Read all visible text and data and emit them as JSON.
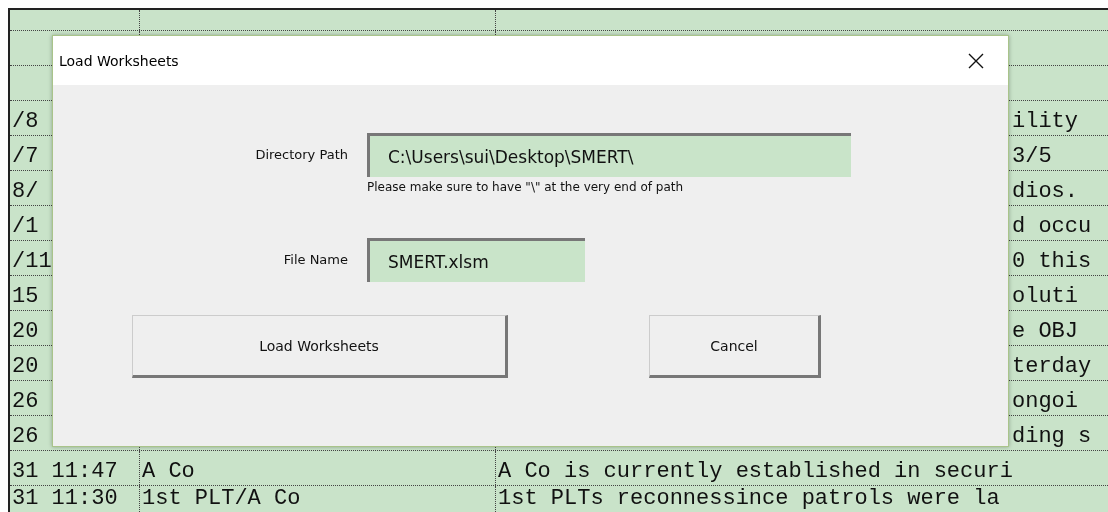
{
  "sheet": {
    "rows": [
      {
        "cells": [
          "",
          "",
          ""
        ]
      },
      {
        "cells": [
          "",
          "",
          ""
        ]
      },
      {
        "cells": [
          "",
          "",
          ""
        ]
      },
      {
        "cells": [
          "/8",
          "",
          "ility"
        ]
      },
      {
        "cells": [
          "/7",
          "",
          "3/5"
        ]
      },
      {
        "cells": [
          "8/",
          "",
          "dios."
        ]
      },
      {
        "cells": [
          "/1",
          "",
          "d occu"
        ]
      },
      {
        "cells": [
          "/11",
          "",
          "0 this"
        ]
      },
      {
        "cells": [
          "15",
          "",
          "oluti"
        ]
      },
      {
        "cells": [
          "20",
          "",
          "e OBJ"
        ]
      },
      {
        "cells": [
          "20",
          "",
          "terday"
        ]
      },
      {
        "cells": [
          "26",
          "",
          "ongoi"
        ]
      },
      {
        "cells": [
          "26",
          "",
          "ding s"
        ]
      },
      {
        "cells": [
          "31 11:47",
          "A Co",
          "A Co is currently established in securi"
        ]
      },
      {
        "cells": [
          "31 11:30",
          "1st PLT/A Co",
          "1st PLTs reconnessince patrols were la"
        ]
      }
    ]
  },
  "dialog": {
    "title": "Load Worksheets",
    "fields": [
      {
        "label": "Directory Path",
        "value": "C:\\Users\\sui\\Desktop\\SMERT\\",
        "hint": "Please make sure to have \"\\\" at the very end of path"
      },
      {
        "label": "File Name",
        "value": "SMERT.xlsm"
      }
    ],
    "buttons": [
      {
        "label": "Load Worksheets",
        "kind": "primary"
      },
      {
        "label": "Cancel",
        "kind": "cancel"
      }
    ]
  }
}
